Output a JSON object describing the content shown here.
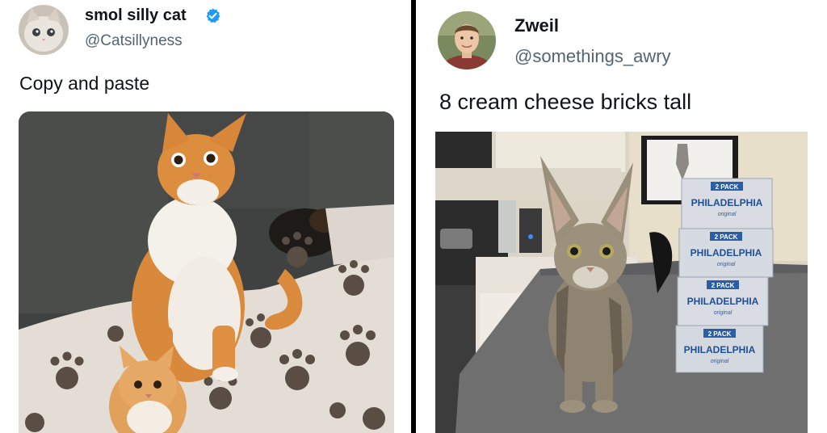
{
  "tweets": [
    {
      "display_name": "smol silly cat",
      "verified": true,
      "handle": "@Catsillyness",
      "text": "Copy and paste",
      "avatar_icon": "cat-avatar",
      "photo": "orange-cat-with-kitten-on-paw-print-blanket"
    },
    {
      "display_name": "Zweil",
      "verified": false,
      "handle": "@somethings_awry",
      "text": "8 cream cheese bricks tall",
      "avatar_icon": "man-avatar",
      "photo": "tabby-kitten-beside-stacked-cream-cheese-boxes",
      "box_labels": {
        "pack": "2 PACK",
        "brand": "PHILADELPHIA",
        "variant": "original"
      }
    }
  ],
  "colors": {
    "verified_blue": "#1d9bf0",
    "handle_gray": "#536471",
    "divider": "#000000"
  }
}
